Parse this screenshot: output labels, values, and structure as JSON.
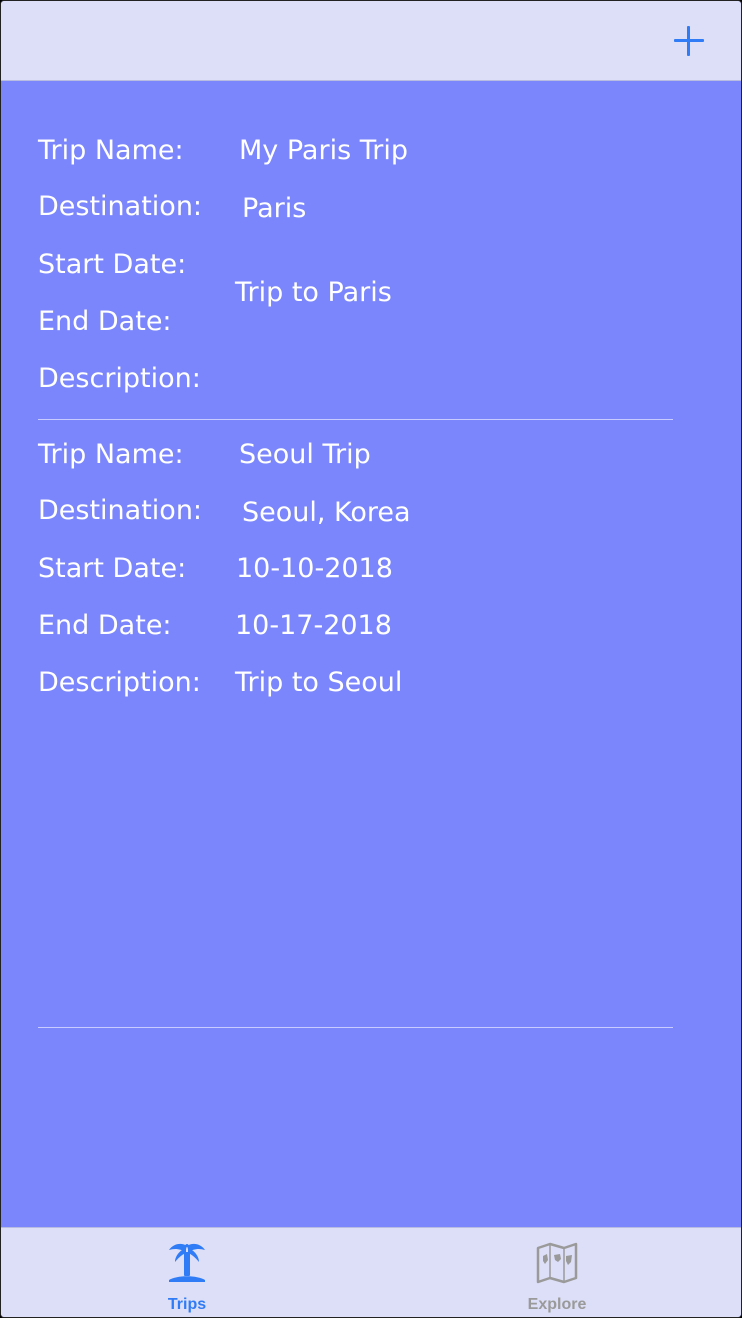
{
  "navbar": {
    "add_icon": "plus-icon",
    "accent_color": "#2f7cf6"
  },
  "trips": [
    {
      "labels": {
        "name": "Trip Name:",
        "destination": "Destination:",
        "start": "Start Date:",
        "end": "End Date:",
        "description": "Description:"
      },
      "name": "My Paris Trip",
      "destination": "Paris",
      "description": "Trip to Paris"
    },
    {
      "labels": {
        "name": "Trip Name:",
        "destination": "Destination:",
        "start": "Start Date:",
        "end": "End Date:",
        "description": "Description:"
      },
      "name": "Seoul Trip",
      "destination": "Seoul, Korea",
      "start_date": "10-10-2018",
      "end_date": "10-17-2018",
      "description": "Trip to Seoul"
    }
  ],
  "tabbar": {
    "tabs": [
      {
        "label": "Trips",
        "icon": "palm-tree-icon",
        "active": true
      },
      {
        "label": "Explore",
        "icon": "map-icon",
        "active": false
      }
    ]
  },
  "colors": {
    "background": "#7b86fd",
    "bars": "#dcdff7",
    "active_tab": "#2f7cf6",
    "inactive_tab": "#9a9a9a"
  }
}
